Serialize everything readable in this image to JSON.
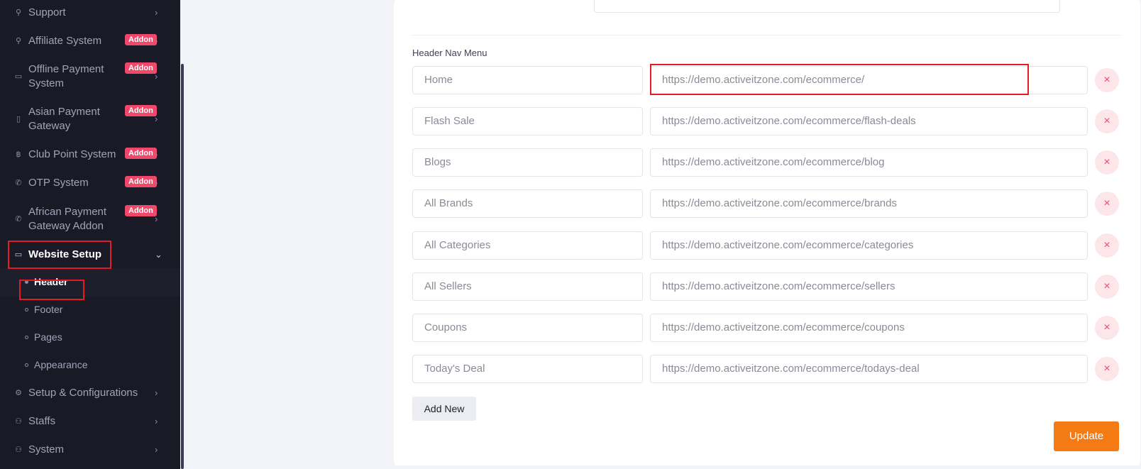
{
  "sidebar": {
    "items": [
      {
        "label": "Support",
        "icon": "link-icon",
        "addon": ""
      },
      {
        "label": "Affiliate System",
        "icon": "link-icon",
        "addon": "Addon"
      },
      {
        "label": "Offline Payment System",
        "icon": "cash-icon",
        "addon": "Addon"
      },
      {
        "label": "Asian Payment Gateway",
        "icon": "phone-icon",
        "addon": "Addon"
      },
      {
        "label": "Club Point System",
        "icon": "coin-icon",
        "addon": "Addon"
      },
      {
        "label": "OTP System",
        "icon": "phone-call-icon",
        "addon": "Addon"
      },
      {
        "label": "African Payment Gateway Addon",
        "icon": "phone-call-icon",
        "addon": "Addon"
      },
      {
        "label": "Website Setup",
        "icon": "monitor-icon",
        "addon": ""
      },
      {
        "label": "Setup & Configurations",
        "icon": "gear-icon",
        "addon": ""
      },
      {
        "label": "Staffs",
        "icon": "user-icon",
        "addon": ""
      },
      {
        "label": "System",
        "icon": "user-icon",
        "addon": ""
      }
    ],
    "subitems": [
      {
        "label": "Header"
      },
      {
        "label": "Footer"
      },
      {
        "label": "Pages"
      },
      {
        "label": "Appearance"
      }
    ]
  },
  "main": {
    "section_label": "Header Nav Menu",
    "rows": [
      {
        "label": "Home",
        "link": "https://demo.activeitzone.com/ecommerce/"
      },
      {
        "label": "Flash Sale",
        "link": "https://demo.activeitzone.com/ecommerce/flash-deals"
      },
      {
        "label": "Blogs",
        "link": "https://demo.activeitzone.com/ecommerce/blog"
      },
      {
        "label": "All Brands",
        "link": "https://demo.activeitzone.com/ecommerce/brands"
      },
      {
        "label": "All Categories",
        "link": "https://demo.activeitzone.com/ecommerce/categories"
      },
      {
        "label": "All Sellers",
        "link": "https://demo.activeitzone.com/ecommerce/sellers"
      },
      {
        "label": "Coupons",
        "link": "https://demo.activeitzone.com/ecommerce/coupons"
      },
      {
        "label": "Today's Deal",
        "link": "https://demo.activeitzone.com/ecommerce/todays-deal"
      }
    ],
    "remove_symbol": "×",
    "add_new_label": "Add New",
    "update_label": "Update"
  },
  "colors": {
    "sidebar_bg": "#1a1a27",
    "addon_badge": "#ef486a",
    "update_button": "#f47b13",
    "highlight": "#e31b23"
  }
}
